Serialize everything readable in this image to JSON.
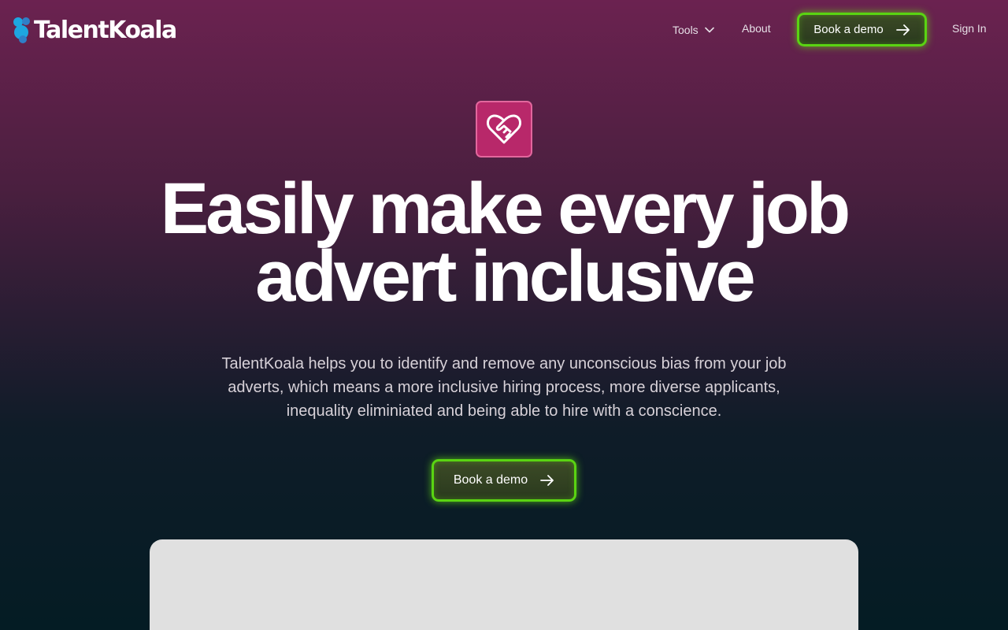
{
  "brand": {
    "name": "TalentKoala"
  },
  "nav": {
    "tools_label": "Tools",
    "about_label": "About",
    "demo_label": "Book a demo",
    "signin_label": "Sign In"
  },
  "hero": {
    "icon": "heart-handshake-icon",
    "headline": "Easily make every job advert inclusive",
    "subheadline": "TalentKoala helps you to identify and remove any unconscious bias from your job adverts, which means a more inclusive hiring process, more diverse applicants, inequality eliminiated and being able to hire with a conscience.",
    "cta_label": "Book a demo"
  },
  "colors": {
    "accent_glow": "#5ad412",
    "icon_bg": "#b8286a",
    "logo_blue": "#1ea6e0"
  }
}
